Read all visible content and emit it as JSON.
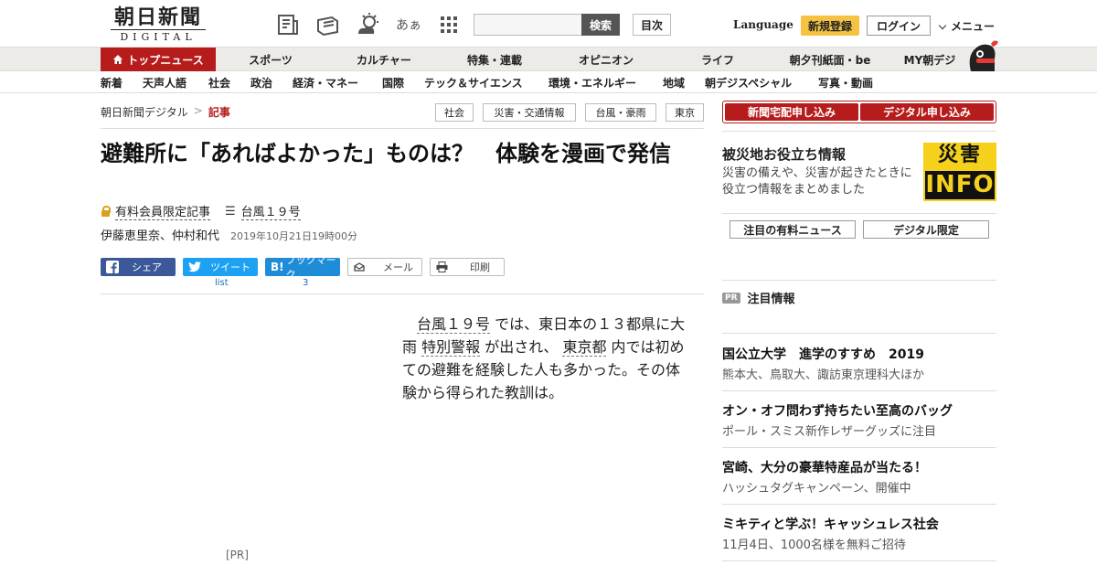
{
  "header": {
    "logo_kanji": "朝日新聞",
    "logo_digital": "DIGITAL",
    "icons": [
      "newspaper-icon",
      "magazine-icon",
      "weather-icon",
      "font-size-icon",
      "grid-menu-icon"
    ],
    "font_icon_text": "あぁ",
    "search_placeholder": "",
    "search_button": "検索",
    "mokuji_button": "目次",
    "language": "Language",
    "signup": "新規登録",
    "login": "ログイン",
    "menu": "メニュー"
  },
  "nav_main": [
    "トップニュース",
    "スポーツ",
    "カルチャー",
    "特集・連載",
    "オピニオン",
    "ライフ",
    "朝夕刊紙面・be",
    "MY朝デジ"
  ],
  "nav_sub": [
    "新着",
    "天声人語",
    "社会",
    "政治",
    "経済・マネー",
    "国際",
    "テック＆サイエンス",
    "環境・エネルギー",
    "地域",
    "朝デジスペシャル",
    "写真・動画"
  ],
  "breadcrumb": {
    "home": "朝日新聞デジタル",
    "sep": ">",
    "current": "記事"
  },
  "tags": [
    "社会",
    "災害・交通情報",
    "台風・豪雨",
    "東京"
  ],
  "article": {
    "title": "避難所に「あればよかった」ものは？　体験を漫画で発信",
    "paid_label": "有料会員限定記事",
    "series": "台風１９号",
    "authors": "伊藤恵里奈、仲村和代",
    "date": "2019年10月21日19時00分",
    "lead": {
      "kw1": "台風１９号",
      "t1": " では、東日本の１３都県に大雨 ",
      "kw2": "特別警報",
      "t2": " が出され、 ",
      "kw3": "東京都",
      "t3": " 内では初めての避難を経験した人も多かった。その体験から得られた教訓は。"
    },
    "pr_label": "[PR]"
  },
  "share": {
    "facebook": "シェア",
    "twitter": "ツイート",
    "hatena": "ブックマーク",
    "mail": "メール",
    "print": "印刷",
    "twitter_count": "list",
    "hatena_count": "3"
  },
  "sidebar": {
    "subscribe_paper": "新聞宅配申し込み",
    "subscribe_digital": "デジタル申し込み",
    "saigai_title": "被災地お役立ち情報",
    "saigai_desc": "災害の備えや、災害が起きたときに役立つ情報をまとめました",
    "info_kanji": "災害",
    "info_en": "INFO",
    "btn_paid_news": "注目の有料ニュース",
    "btn_digital_only": "デジタル限定",
    "pr_badge": "PR",
    "pr_title": "注目情報",
    "promos": [
      {
        "title": "国公立大学　進学のすすめ　2019",
        "sub": "熊本大、鳥取大、諏訪東京理科大ほか"
      },
      {
        "title": "オン・オフ問わず持ちたい至高のバッグ",
        "sub": "ポール・スミス新作レザーグッズに注目"
      },
      {
        "title": "宮崎、大分の豪華特産品が当たる！",
        "sub": "ハッシュタグキャンペーン、開催中"
      },
      {
        "title": "ミキティと学ぶ！キャッシュレス社会",
        "sub": "11月4日、1000名様を無料ご招待"
      }
    ]
  },
  "colors": {
    "brand_red": "#b71c1c",
    "signup_yellow": "#f5c341",
    "info_yellow": "#f5d11b",
    "facebook": "#3b5998",
    "twitter": "#1da1f2",
    "hatena": "#1e8cd7"
  }
}
